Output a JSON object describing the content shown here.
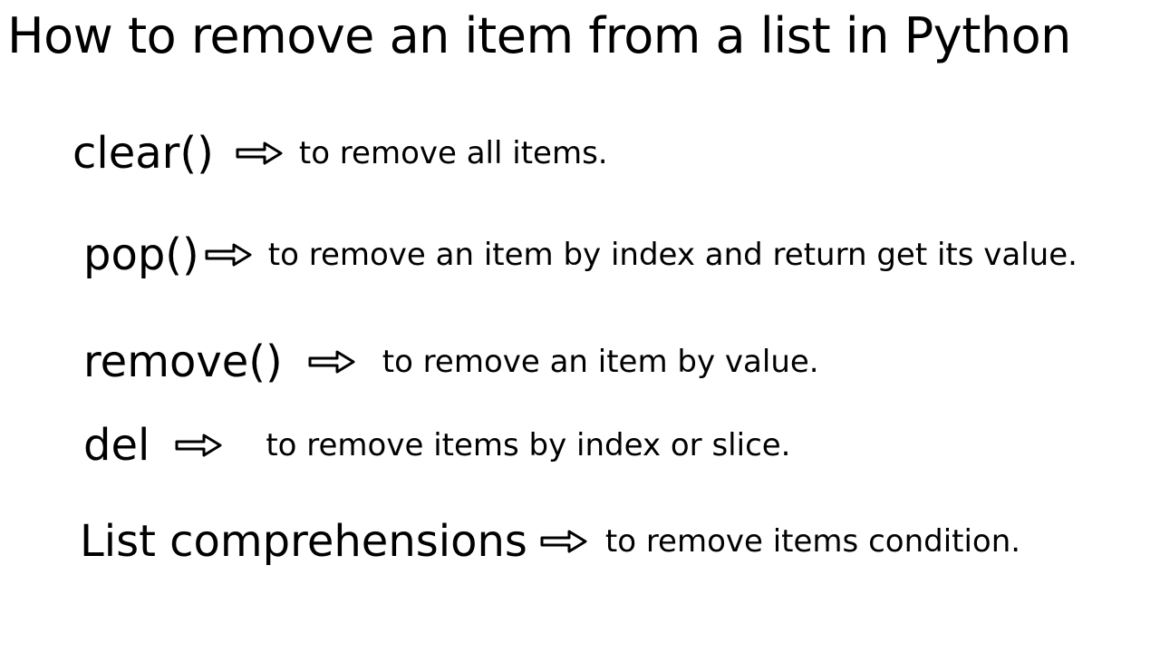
{
  "title": "How to remove an item from a list in Python",
  "rows": [
    {
      "method": "clear()",
      "desc": "to remove all items."
    },
    {
      "method": "pop()",
      "desc": "to remove an item by index and return get its value."
    },
    {
      "method": "remove()",
      "desc": "to remove an item by value."
    },
    {
      "method": "del",
      "desc": "to remove items by index or slice."
    },
    {
      "method": "List comprehensions",
      "desc": "to remove items condition."
    }
  ]
}
